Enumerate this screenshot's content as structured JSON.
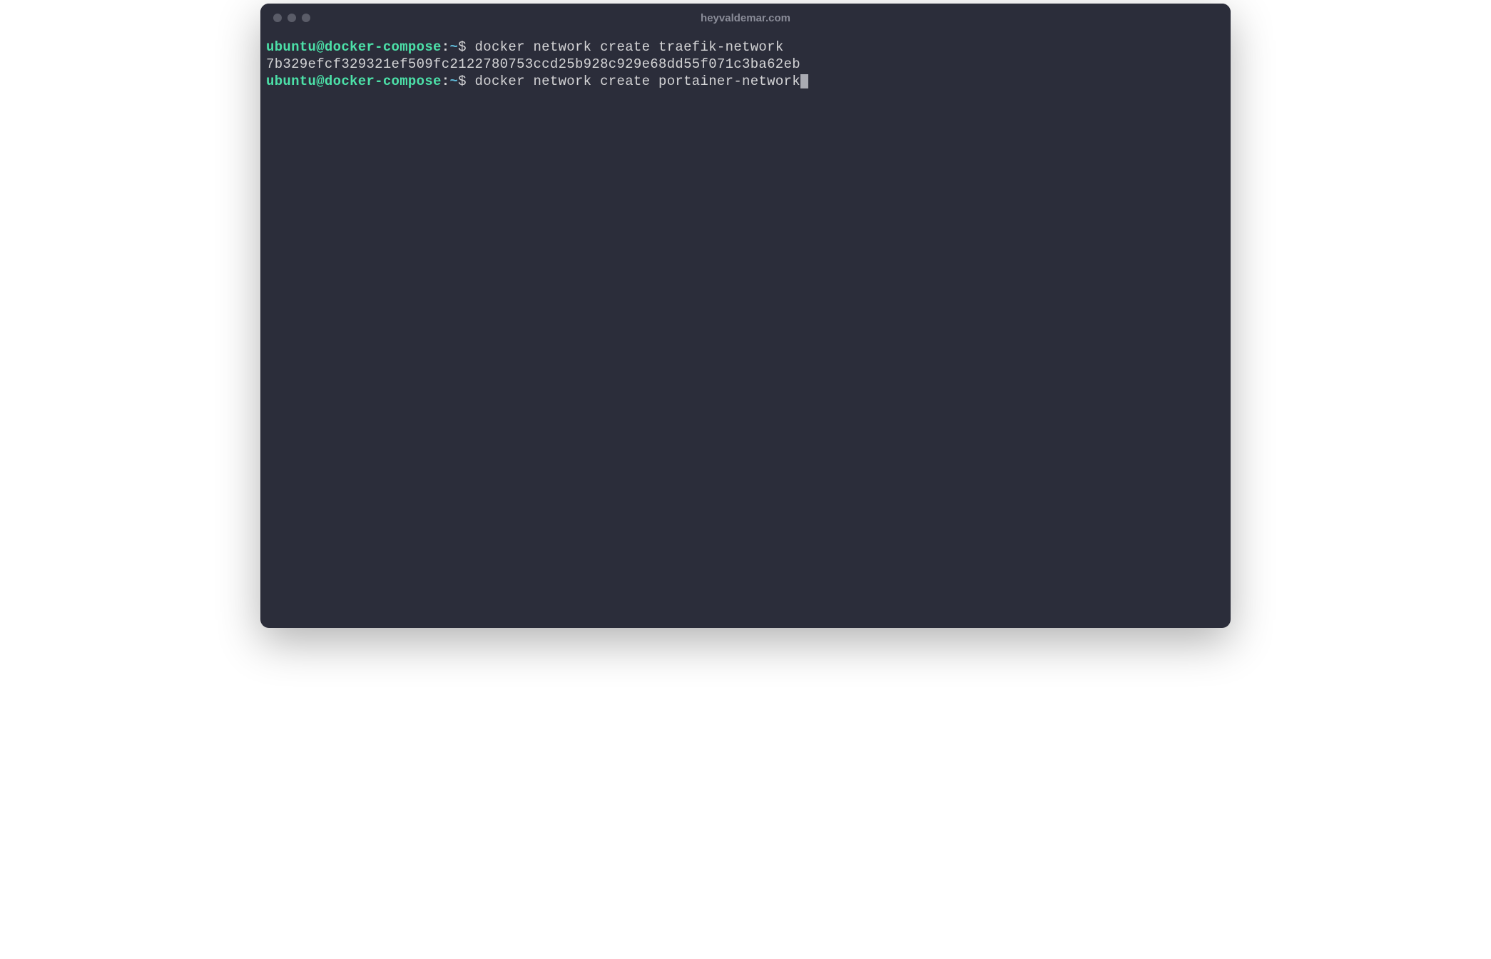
{
  "window": {
    "title": "heyvaldemar.com"
  },
  "prompt": {
    "user_host": "ubuntu@docker-compose",
    "colon": ":",
    "path": "~",
    "symbol": "$"
  },
  "lines": [
    {
      "type": "command",
      "text": " docker network create traefik-network"
    },
    {
      "type": "output",
      "text": "7b329efcf329321ef509fc2122780753ccd25b928c929e68dd55f071c3ba62eb"
    },
    {
      "type": "command",
      "text": " docker network create portainer-network",
      "cursor": true
    }
  ]
}
